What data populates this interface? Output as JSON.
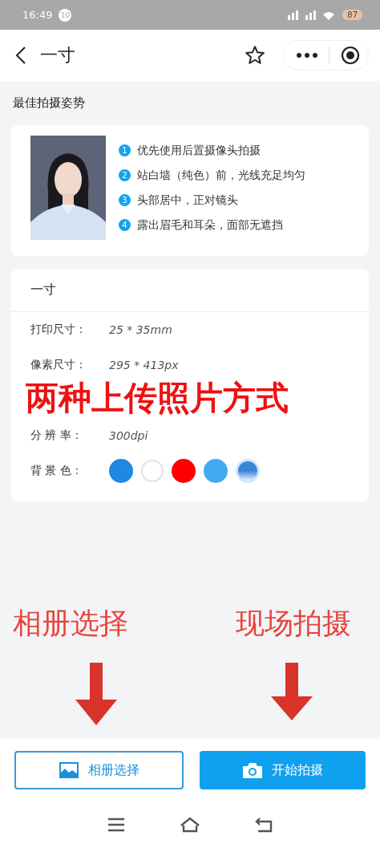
{
  "status_bar": {
    "time": "16:49",
    "notification_count": "10",
    "battery": "87"
  },
  "header": {
    "title": "一寸"
  },
  "section_title": "最佳拍摄姿势",
  "tips": [
    {
      "number": "1",
      "text": "优先使用后置摄像头拍摄"
    },
    {
      "number": "2",
      "text": "站白墙（纯色）前，光线充足均匀"
    },
    {
      "number": "3",
      "text": "头部居中，正对镜头"
    },
    {
      "number": "4",
      "text": "露出眉毛和耳朵，面部无遮挡"
    }
  ],
  "spec_card": {
    "title": "一寸",
    "rows": [
      {
        "label": "打印尺寸：",
        "value": "25 * 35mm"
      },
      {
        "label": "像素尺寸：",
        "value": "295 * 413px"
      },
      {
        "label": "",
        "value": ""
      },
      {
        "label": "分 辨 率：",
        "value": "300dpi"
      }
    ],
    "background_label": "背 景 色：",
    "backgrounds": [
      {
        "color": "#1e88e5",
        "kind": "solid"
      },
      {
        "color": "#ffffff",
        "kind": "outline"
      },
      {
        "color": "#ff0000",
        "kind": "solid"
      },
      {
        "color": "#42aaf0",
        "kind": "solid"
      },
      {
        "color": "#3a86d6",
        "kind": "gradient"
      }
    ]
  },
  "annotations": {
    "headline": "两种上传照片方式",
    "left_label": "相册选择",
    "right_label": "现场拍摄"
  },
  "buttons": [
    {
      "label": "相册选择",
      "kind": "album"
    },
    {
      "label": "开始拍摄",
      "kind": "camera"
    }
  ]
}
